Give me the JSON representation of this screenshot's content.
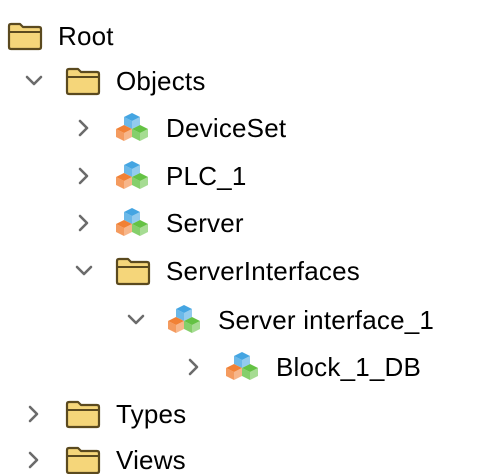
{
  "tree": {
    "nodes": [
      {
        "label": "Root",
        "icon": "folder-icon",
        "expander": "none",
        "depth": 0
      },
      {
        "label": "Objects",
        "icon": "folder-icon",
        "expander": "expanded",
        "depth": 1
      },
      {
        "label": "DeviceSet",
        "icon": "object-cubes-icon",
        "expander": "collapsed",
        "depth": 2
      },
      {
        "label": "PLC_1",
        "icon": "object-cubes-icon",
        "expander": "collapsed",
        "depth": 2
      },
      {
        "label": "Server",
        "icon": "object-cubes-icon",
        "expander": "collapsed",
        "depth": 2
      },
      {
        "label": "ServerInterfaces",
        "icon": "folder-icon",
        "expander": "expanded",
        "depth": 2
      },
      {
        "label": "Server interface_1",
        "icon": "object-cubes-icon",
        "expander": "expanded",
        "depth": 3
      },
      {
        "label": "Block_1_DB",
        "icon": "object-cubes-icon",
        "expander": "collapsed",
        "depth": 4
      },
      {
        "label": "Types",
        "icon": "folder-icon",
        "expander": "collapsed",
        "depth": 1
      },
      {
        "label": "Views",
        "icon": "folder-icon",
        "expander": "collapsed",
        "depth": 1
      }
    ]
  },
  "colors": {
    "folder_fill": "#f5d67a",
    "folder_stroke": "#5b4a1f",
    "cube_blue": "#3aa0e0",
    "cube_orange": "#f07a2a",
    "cube_green": "#5cbf3a",
    "chevron": "#6b6b6b"
  }
}
